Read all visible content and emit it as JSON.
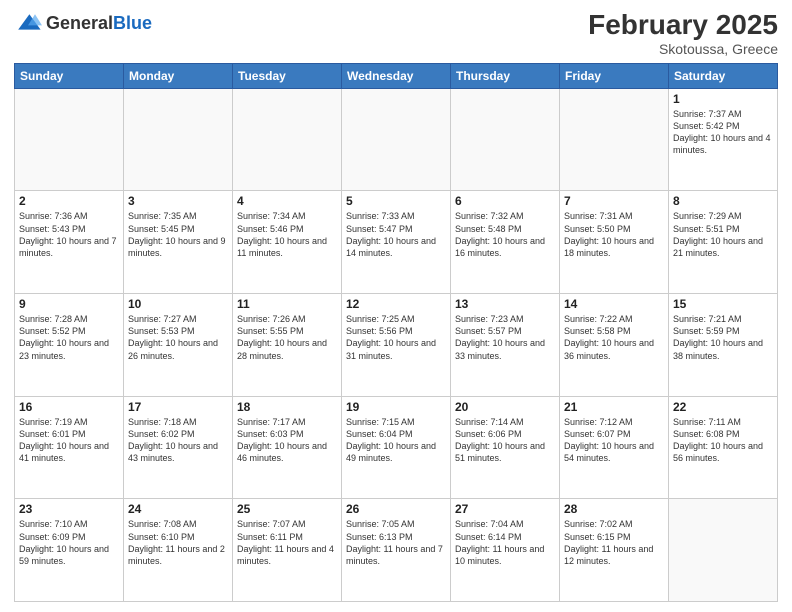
{
  "header": {
    "logo": {
      "general": "General",
      "blue": "Blue"
    },
    "month_year": "February 2025",
    "location": "Skotoussa, Greece"
  },
  "calendar": {
    "days_of_week": [
      "Sunday",
      "Monday",
      "Tuesday",
      "Wednesday",
      "Thursday",
      "Friday",
      "Saturday"
    ],
    "weeks": [
      [
        {
          "day": "",
          "info": ""
        },
        {
          "day": "",
          "info": ""
        },
        {
          "day": "",
          "info": ""
        },
        {
          "day": "",
          "info": ""
        },
        {
          "day": "",
          "info": ""
        },
        {
          "day": "",
          "info": ""
        },
        {
          "day": "1",
          "info": "Sunrise: 7:37 AM\nSunset: 5:42 PM\nDaylight: 10 hours\nand 4 minutes."
        }
      ],
      [
        {
          "day": "2",
          "info": "Sunrise: 7:36 AM\nSunset: 5:43 PM\nDaylight: 10 hours\nand 7 minutes."
        },
        {
          "day": "3",
          "info": "Sunrise: 7:35 AM\nSunset: 5:45 PM\nDaylight: 10 hours\nand 9 minutes."
        },
        {
          "day": "4",
          "info": "Sunrise: 7:34 AM\nSunset: 5:46 PM\nDaylight: 10 hours\nand 11 minutes."
        },
        {
          "day": "5",
          "info": "Sunrise: 7:33 AM\nSunset: 5:47 PM\nDaylight: 10 hours\nand 14 minutes."
        },
        {
          "day": "6",
          "info": "Sunrise: 7:32 AM\nSunset: 5:48 PM\nDaylight: 10 hours\nand 16 minutes."
        },
        {
          "day": "7",
          "info": "Sunrise: 7:31 AM\nSunset: 5:50 PM\nDaylight: 10 hours\nand 18 minutes."
        },
        {
          "day": "8",
          "info": "Sunrise: 7:29 AM\nSunset: 5:51 PM\nDaylight: 10 hours\nand 21 minutes."
        }
      ],
      [
        {
          "day": "9",
          "info": "Sunrise: 7:28 AM\nSunset: 5:52 PM\nDaylight: 10 hours\nand 23 minutes."
        },
        {
          "day": "10",
          "info": "Sunrise: 7:27 AM\nSunset: 5:53 PM\nDaylight: 10 hours\nand 26 minutes."
        },
        {
          "day": "11",
          "info": "Sunrise: 7:26 AM\nSunset: 5:55 PM\nDaylight: 10 hours\nand 28 minutes."
        },
        {
          "day": "12",
          "info": "Sunrise: 7:25 AM\nSunset: 5:56 PM\nDaylight: 10 hours\nand 31 minutes."
        },
        {
          "day": "13",
          "info": "Sunrise: 7:23 AM\nSunset: 5:57 PM\nDaylight: 10 hours\nand 33 minutes."
        },
        {
          "day": "14",
          "info": "Sunrise: 7:22 AM\nSunset: 5:58 PM\nDaylight: 10 hours\nand 36 minutes."
        },
        {
          "day": "15",
          "info": "Sunrise: 7:21 AM\nSunset: 5:59 PM\nDaylight: 10 hours\nand 38 minutes."
        }
      ],
      [
        {
          "day": "16",
          "info": "Sunrise: 7:19 AM\nSunset: 6:01 PM\nDaylight: 10 hours\nand 41 minutes."
        },
        {
          "day": "17",
          "info": "Sunrise: 7:18 AM\nSunset: 6:02 PM\nDaylight: 10 hours\nand 43 minutes."
        },
        {
          "day": "18",
          "info": "Sunrise: 7:17 AM\nSunset: 6:03 PM\nDaylight: 10 hours\nand 46 minutes."
        },
        {
          "day": "19",
          "info": "Sunrise: 7:15 AM\nSunset: 6:04 PM\nDaylight: 10 hours\nand 49 minutes."
        },
        {
          "day": "20",
          "info": "Sunrise: 7:14 AM\nSunset: 6:06 PM\nDaylight: 10 hours\nand 51 minutes."
        },
        {
          "day": "21",
          "info": "Sunrise: 7:12 AM\nSunset: 6:07 PM\nDaylight: 10 hours\nand 54 minutes."
        },
        {
          "day": "22",
          "info": "Sunrise: 7:11 AM\nSunset: 6:08 PM\nDaylight: 10 hours\nand 56 minutes."
        }
      ],
      [
        {
          "day": "23",
          "info": "Sunrise: 7:10 AM\nSunset: 6:09 PM\nDaylight: 10 hours\nand 59 minutes."
        },
        {
          "day": "24",
          "info": "Sunrise: 7:08 AM\nSunset: 6:10 PM\nDaylight: 11 hours\nand 2 minutes."
        },
        {
          "day": "25",
          "info": "Sunrise: 7:07 AM\nSunset: 6:11 PM\nDaylight: 11 hours\nand 4 minutes."
        },
        {
          "day": "26",
          "info": "Sunrise: 7:05 AM\nSunset: 6:13 PM\nDaylight: 11 hours\nand 7 minutes."
        },
        {
          "day": "27",
          "info": "Sunrise: 7:04 AM\nSunset: 6:14 PM\nDaylight: 11 hours\nand 10 minutes."
        },
        {
          "day": "28",
          "info": "Sunrise: 7:02 AM\nSunset: 6:15 PM\nDaylight: 11 hours\nand 12 minutes."
        },
        {
          "day": "",
          "info": ""
        }
      ]
    ]
  }
}
